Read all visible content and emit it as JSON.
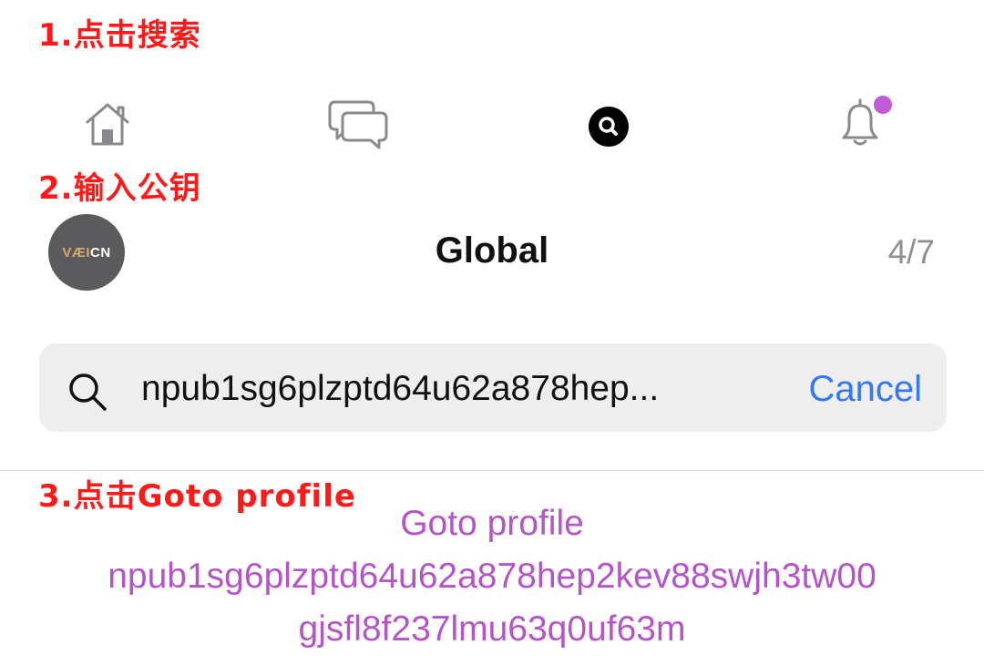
{
  "annotations": {
    "step1": "1.点击搜索",
    "step2": "2.输入公钥",
    "step3": "3.点击Goto profile"
  },
  "nav": {
    "icons": [
      "home-icon",
      "chat-bubbles-icon",
      "search-icon",
      "bell-icon"
    ],
    "active": "search-icon",
    "notification_dot_color": "#c15ad6"
  },
  "header": {
    "avatar_text_accent": "VÆI",
    "avatar_text_main": "CN",
    "title": "Global",
    "counter": "4/7"
  },
  "search": {
    "value": "npub1sg6plzptd64u62a878hep...",
    "cancel_label": "Cancel"
  },
  "result": {
    "line1": "Goto profile",
    "line2": "npub1sg6plzptd64u62a878hep2kev88swjh3tw00",
    "line3": "gjsfl8f237lmu63q0uf63m"
  },
  "colors": {
    "annotation": "#ff1a1a",
    "link": "#3478f6",
    "result": "#b455c7"
  }
}
